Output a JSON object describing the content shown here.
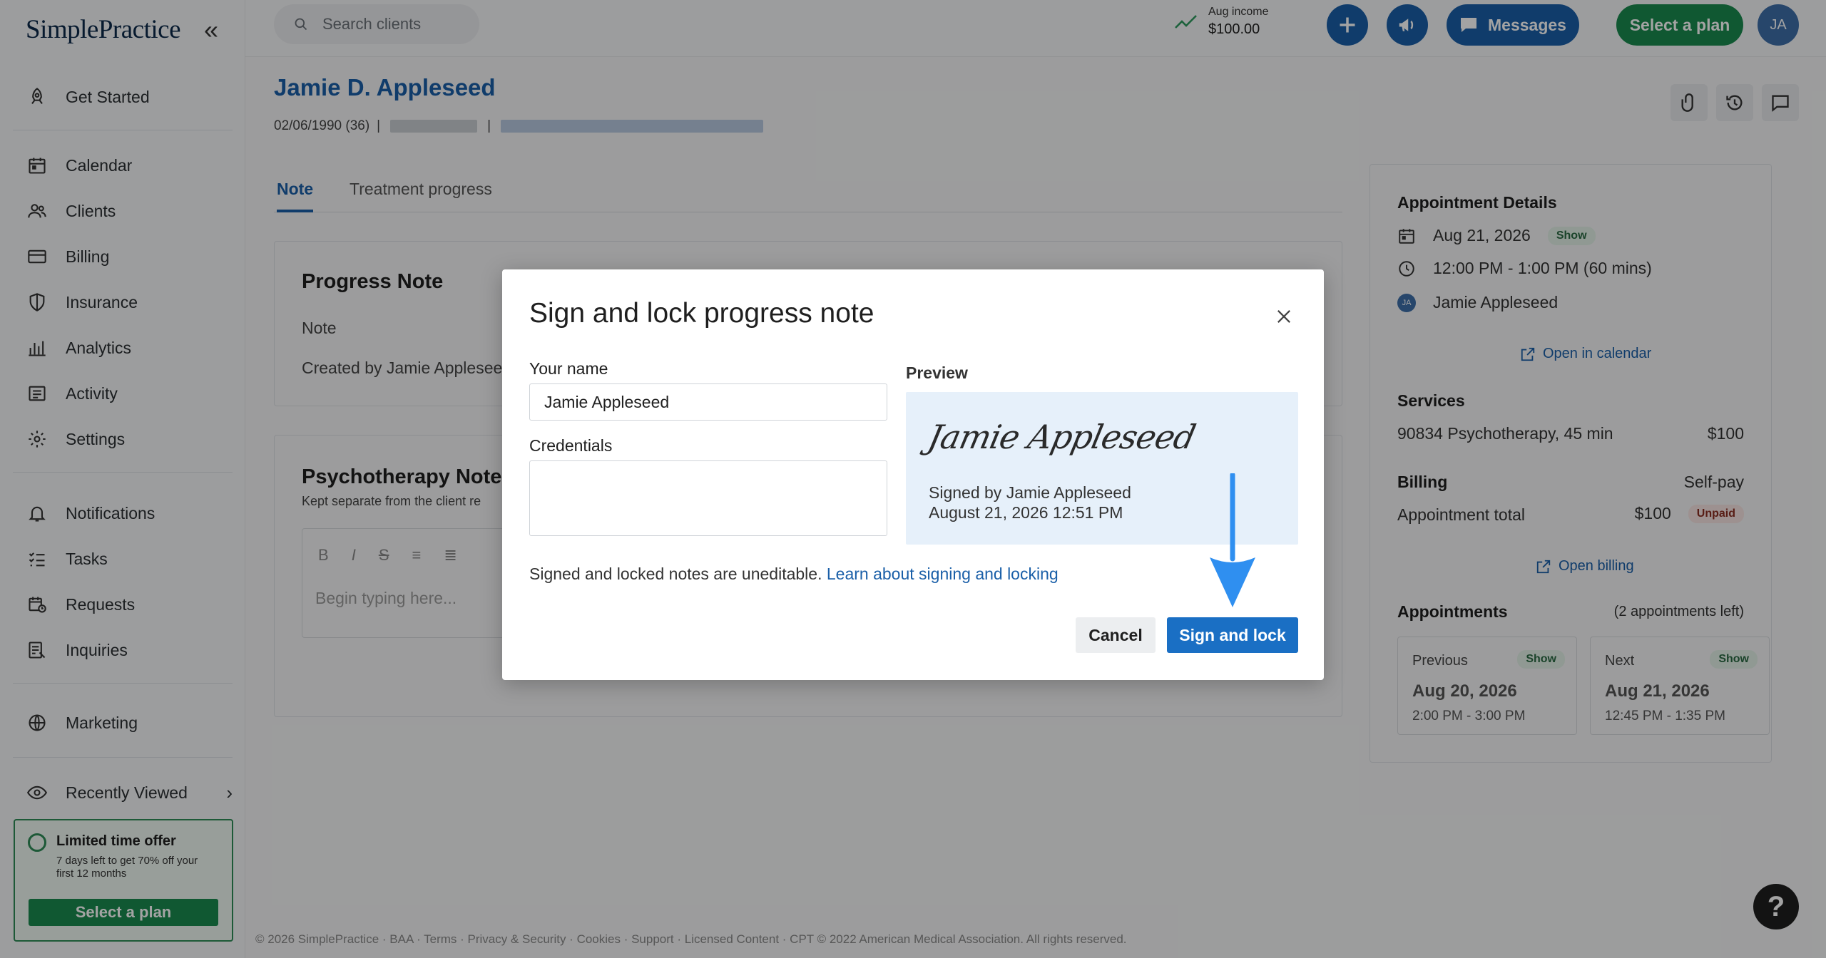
{
  "app": {
    "logo": "SimplePractice",
    "collapse_icon": "«"
  },
  "sidebar": {
    "items": [
      {
        "label": "Get Started",
        "icon": "rocket-icon"
      },
      {
        "label": "Calendar",
        "icon": "calendar-icon"
      },
      {
        "label": "Clients",
        "icon": "clients-icon"
      },
      {
        "label": "Billing",
        "icon": "card-icon"
      },
      {
        "label": "Insurance",
        "icon": "shield-icon"
      },
      {
        "label": "Analytics",
        "icon": "bar-chart-icon"
      },
      {
        "label": "Activity",
        "icon": "list-icon"
      },
      {
        "label": "Settings",
        "icon": "gear-icon"
      },
      {
        "label": "Notifications",
        "icon": "bell-icon"
      },
      {
        "label": "Tasks",
        "icon": "checklist-icon"
      },
      {
        "label": "Requests",
        "icon": "calendar-clock-icon"
      },
      {
        "label": "Inquiries",
        "icon": "inquiry-icon"
      },
      {
        "label": "Marketing",
        "icon": "globe-icon"
      },
      {
        "label": "Recently Viewed",
        "icon": "eye-icon"
      }
    ],
    "offer": {
      "title": "Limited time offer",
      "text": "7 days left to get 70% off your first 12 months",
      "button": "Select a plan"
    }
  },
  "topbar": {
    "search_placeholder": "Search clients",
    "income_label": "Aug income",
    "income_value": "$100.00",
    "messages_label": "Messages",
    "plan_label": "Select a plan",
    "avatar_initials": "JA"
  },
  "client": {
    "name": "Jamie D. Appleseed",
    "dob": "02/06/1990 (36)",
    "separator": "|"
  },
  "tabs": [
    {
      "label": "Note",
      "active": true
    },
    {
      "label": "Treatment progress",
      "active": false
    }
  ],
  "progress_note": {
    "title": "Progress Note",
    "subtitle": "Note",
    "created_by": "Created by Jamie Appleseed"
  },
  "psychotherapy_note": {
    "title": "Psychotherapy Note",
    "subtitle": "Kept separate from the client re",
    "placeholder": "Begin typing here..."
  },
  "appointment": {
    "heading": "Appointment Details",
    "date": "Aug 21, 2026",
    "status": "Show",
    "time": "12:00 PM - 1:00 PM (60 mins)",
    "client": "Jamie Appleseed",
    "client_initials": "JA",
    "open_calendar": "Open in calendar",
    "services_heading": "Services",
    "service": "90834 Psychotherapy, 45 min",
    "service_price": "$100",
    "billing_heading": "Billing",
    "billing_type": "Self-pay",
    "total_label": "Appointment total",
    "total_value": "$100",
    "payment_status": "Unpaid",
    "open_billing": "Open billing",
    "appointments_heading": "Appointments",
    "appointments_left": "(2 appointments left)",
    "previous": {
      "label": "Previous",
      "status": "Show",
      "date": "Aug 20, 2026",
      "time": "2:00 PM - 3:00 PM"
    },
    "next": {
      "label": "Next",
      "status": "Show",
      "date": "Aug 21, 2026",
      "time": "12:45 PM - 1:35 PM"
    }
  },
  "footer": "© 2026 SimplePractice · BAA · Terms · Privacy & Security · Cookies · Support · Licensed Content · CPT © 2022 American Medical Association. All rights reserved.",
  "help": "?",
  "modal": {
    "title": "Sign and lock progress note",
    "name_label": "Your name",
    "name_value": "Jamie Appleseed",
    "credentials_label": "Credentials",
    "credentials_value": "",
    "preview_label": "Preview",
    "signature": "Jamie Appleseed",
    "signed_by": "Signed by Jamie Appleseed",
    "signed_at": "August 21, 2026 12:51 PM",
    "note_text": "Signed and locked notes are uneditable.",
    "note_link": "Learn about signing and locking",
    "cancel": "Cancel",
    "sign": "Sign and lock"
  },
  "colors": {
    "brand_blue": "#1a5fa8",
    "action_blue": "#1a6fc4",
    "brand_green": "#1a8a4f",
    "annotation_arrow": "#2f8ff0"
  }
}
